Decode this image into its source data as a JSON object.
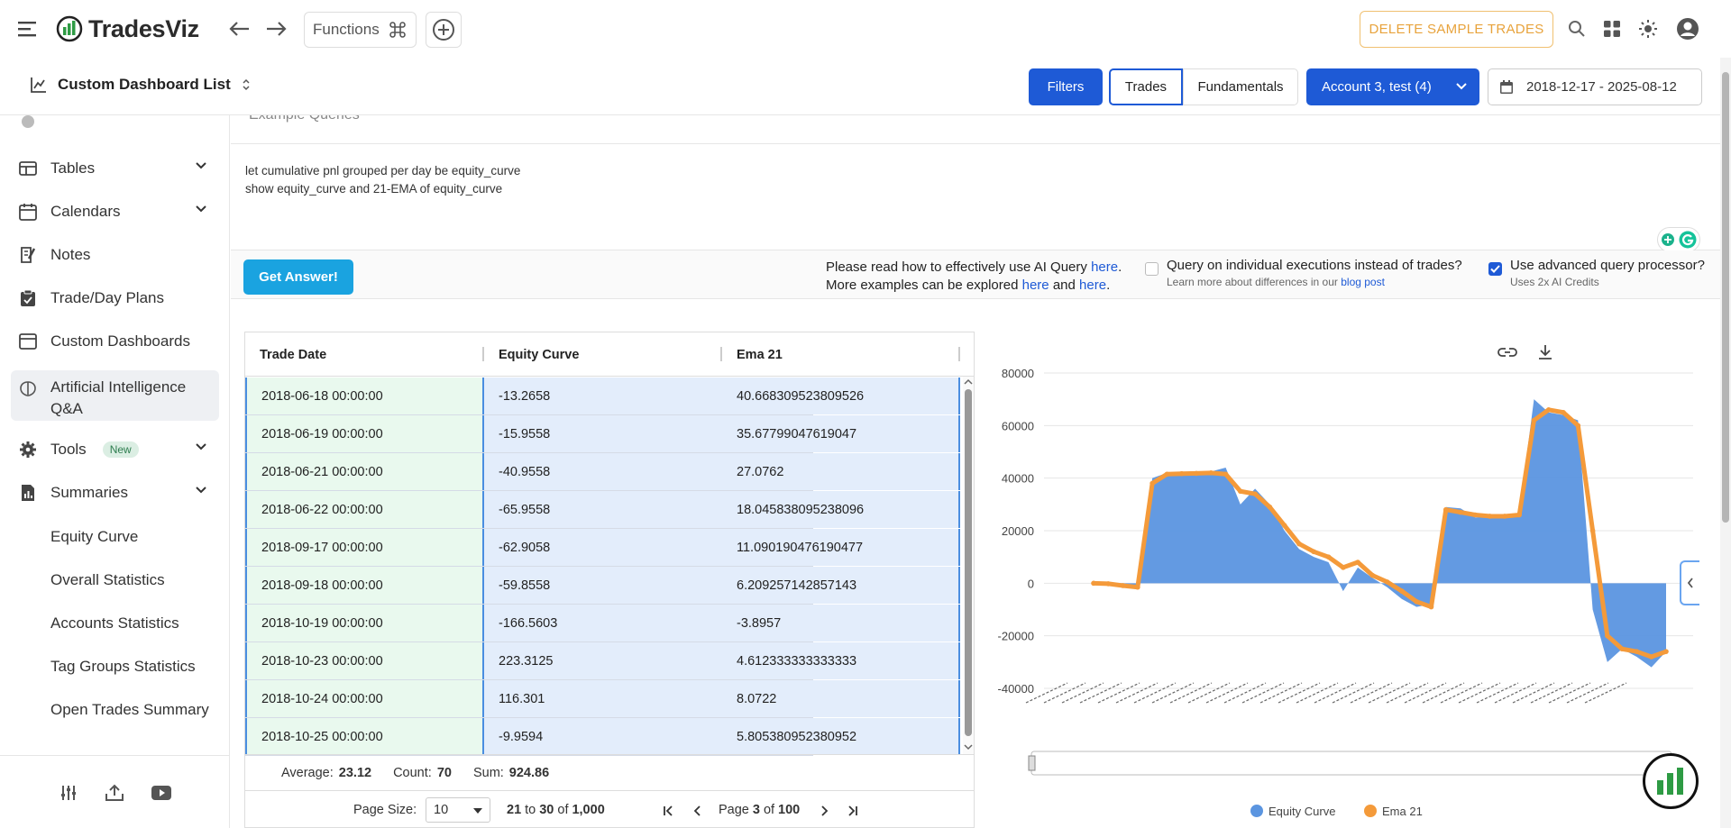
{
  "topbar": {
    "brand": "TradesViz",
    "functions_label": "Functions",
    "delete_label": "DELETE SAMPLE TRADES"
  },
  "subbar": {
    "dashboard_title": "Custom Dashboard List",
    "filters_label": "Filters",
    "trades_label": "Trades",
    "fundamentals_label": "Fundamentals",
    "account_label": "Account 3, test (4)",
    "date_range": "2018-12-17 - 2025-08-12"
  },
  "sidebar": {
    "items": [
      {
        "label": "Tables",
        "icon": "table-icon",
        "has_chevron": true
      },
      {
        "label": "Calendars",
        "icon": "calendar-icon",
        "has_chevron": true
      },
      {
        "label": "Notes",
        "icon": "notes-icon",
        "has_chevron": false
      },
      {
        "label": "Trade/Day Plans",
        "icon": "clipboard-icon",
        "has_chevron": false
      },
      {
        "label": "Custom Dashboards",
        "icon": "dashboard-icon",
        "has_chevron": false
      },
      {
        "label": "Artificial Intelligence Q&A",
        "icon": "brain-icon",
        "has_chevron": false,
        "active": true
      },
      {
        "label": "Tools",
        "icon": "gear-icon",
        "has_chevron": true,
        "badge": "New"
      },
      {
        "label": "Summaries",
        "icon": "summaries-icon",
        "has_chevron": true
      }
    ],
    "sub_items": [
      "Equity Curve",
      "Overall Statistics",
      "Accounts Statistics",
      "Tag Groups Statistics",
      "Open Trades Summary"
    ]
  },
  "main": {
    "example_header": "Example Queries",
    "query_lines": [
      "let cumulative pnl grouped per day be equity_curve",
      "show equity_curve and 21-EMA of equity_curve"
    ],
    "get_answer": "Get Answer!",
    "hint_line1_prefix": "Please read how to effectively use AI Query ",
    "hint_here": "here",
    "hint_line2_prefix": "More examples can be explored ",
    "hint_and": " and ",
    "exec_label": "Query on individual executions instead of trades?",
    "exec_sub_prefix": "Learn more about differences in our ",
    "blog_post": "blog post",
    "advanced_label": "Use advanced query processor?",
    "advanced_sub": "Uses 2x AI Credits",
    "advanced_checked": true
  },
  "table": {
    "headers": [
      "Trade Date",
      "Equity Curve",
      "Ema 21"
    ],
    "rows": [
      [
        "2018-06-18 00:00:00",
        "-13.2658",
        "40.668309523809526"
      ],
      [
        "2018-06-19 00:00:00",
        "-15.9558",
        "35.67799047619047"
      ],
      [
        "2018-06-21 00:00:00",
        "-40.9558",
        "27.0762"
      ],
      [
        "2018-06-22 00:00:00",
        "-65.9558",
        "18.045838095238096"
      ],
      [
        "2018-09-17 00:00:00",
        "-62.9058",
        "11.090190476190477"
      ],
      [
        "2018-09-18 00:00:00",
        "-59.8558",
        "6.209257142857143"
      ],
      [
        "2018-10-19 00:00:00",
        "-166.5603",
        "-3.8957"
      ],
      [
        "2018-10-23 00:00:00",
        "223.3125",
        "4.612333333333333"
      ],
      [
        "2018-10-24 00:00:00",
        "116.301",
        "8.0722"
      ],
      [
        "2018-10-25 00:00:00",
        "-9.9594",
        "5.805380952380952"
      ]
    ],
    "avg_label": "Average:",
    "avg_value": "23.12",
    "count_label": "Count:",
    "count_value": "70",
    "sum_label": "Sum:",
    "sum_value": "924.86",
    "page_size_label": "Page Size:",
    "page_size": "10",
    "range_from": "21",
    "range_to_word": "to",
    "range_to": "30",
    "range_of_word": "of",
    "range_total": "1,000",
    "page_label": "Page",
    "page_current": "3",
    "page_of_word": "of",
    "page_total": "100"
  },
  "chart_data": {
    "type": "area",
    "series": [
      {
        "name": "Equity Curve",
        "color": "#5b95e0"
      },
      {
        "name": "Ema 21",
        "color": "#f49a3a"
      }
    ],
    "yticks": [
      "80000",
      "60000",
      "40000",
      "20000",
      "0",
      "-20000",
      "-40000"
    ],
    "ylim": [
      -40000,
      80000
    ],
    "x": [
      0,
      1,
      2,
      3,
      4,
      5,
      6,
      7,
      8,
      9,
      10,
      11,
      12,
      13,
      14,
      15,
      16,
      17,
      18,
      19,
      20,
      21,
      22,
      23,
      24,
      25,
      26,
      27,
      28,
      29,
      30,
      31,
      32,
      33,
      34,
      35,
      36,
      37,
      38,
      39
    ],
    "equity": [
      0,
      -500,
      -1500,
      -2000,
      40000,
      42000,
      41000,
      41500,
      42500,
      44000,
      30000,
      36000,
      30000,
      20000,
      13000,
      10000,
      8000,
      -3000,
      6000,
      2000,
      -1500,
      -6000,
      -9000,
      -8000,
      29000,
      28500,
      25000,
      25500,
      25000,
      27000,
      70000,
      65000,
      64000,
      62000,
      -10000,
      -30000,
      -25000,
      -28000,
      -32000,
      -26000
    ],
    "ema": [
      0,
      -200,
      -900,
      -1500,
      38000,
      41500,
      41700,
      41800,
      42000,
      41500,
      35000,
      34000,
      29000,
      22000,
      15000,
      12000,
      10000,
      6000,
      8000,
      3000,
      500,
      -3000,
      -7000,
      -9000,
      28000,
      27000,
      26000,
      25500,
      25500,
      26000,
      62000,
      66000,
      65000,
      60000,
      20000,
      -20000,
      -25000,
      -26000,
      -28000,
      -26000
    ],
    "legend": [
      "Equity Curve",
      "Ema 21"
    ],
    "legend_position": "bottom"
  }
}
